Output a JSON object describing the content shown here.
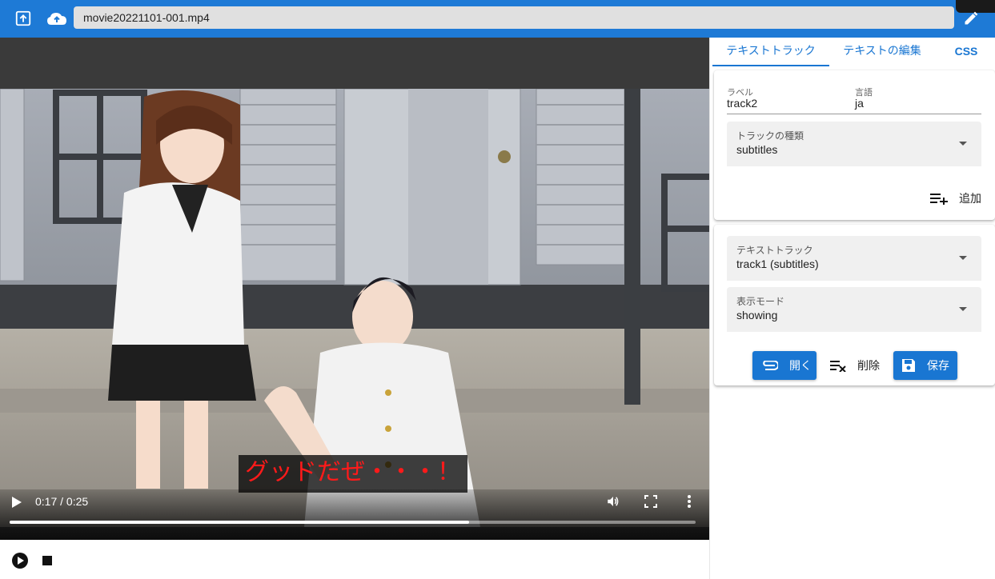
{
  "file": {
    "name": "movie20221101-001.mp4"
  },
  "video": {
    "time": "0:17 / 0:25",
    "progress": 0.67,
    "subtitle": "グッドだぜ・・・！"
  },
  "tabs": [
    {
      "label": "テキストトラック",
      "active": true
    },
    {
      "label": "テキストの編集",
      "active": false
    },
    {
      "label": "CSS",
      "active": false
    }
  ],
  "track_form": {
    "label_caption": "ラベル",
    "label_value": "track2",
    "lang_caption": "言語",
    "lang_value": "ja",
    "kind_caption": "トラックの種類",
    "kind_value": "subtitles",
    "add_label": "追加"
  },
  "track_list": {
    "track_caption": "テキストトラック",
    "track_value": "track1 (subtitles)",
    "mode_caption": "表示モード",
    "mode_value": "showing",
    "open_label": "開く",
    "delete_label": "削除",
    "save_label": "保存"
  },
  "colors": {
    "accent": "#1976d2",
    "appbar": "#1e7ad6",
    "subtitle": "#ff1a1a"
  }
}
